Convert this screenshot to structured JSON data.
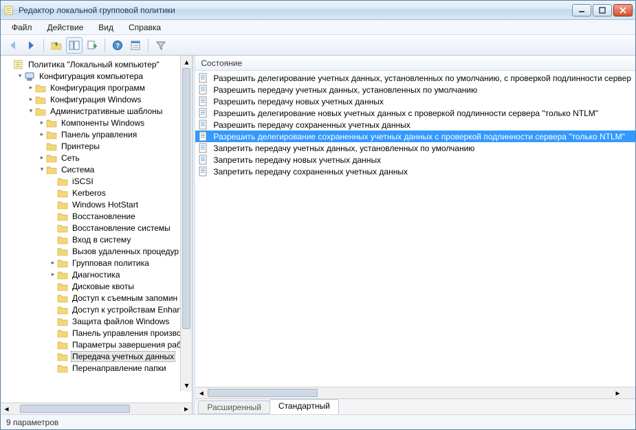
{
  "window": {
    "title": "Редактор локальной групповой политики"
  },
  "menubar": {
    "items": [
      "Файл",
      "Действие",
      "Вид",
      "Справка"
    ]
  },
  "toolbar": {
    "back": "back-icon",
    "forward": "forward-icon",
    "up": "up-icon",
    "show_hide": "show-hide-tree-icon",
    "export": "export-list-icon",
    "help": "help-icon",
    "props": "properties-icon",
    "filter": "filter-icon"
  },
  "tree": {
    "root": {
      "label": "Политика \"Локальный компьютер\"",
      "children": [
        {
          "label": "Конфигурация компьютера",
          "expanded": true,
          "children": [
            {
              "label": "Конфигурация программ",
              "expandable": true
            },
            {
              "label": "Конфигурация Windows",
              "expandable": true
            },
            {
              "label": "Административные шаблоны",
              "expanded": true,
              "children": [
                {
                  "label": "Компоненты Windows",
                  "expandable": true
                },
                {
                  "label": "Панель управления",
                  "expandable": true
                },
                {
                  "label": "Принтеры"
                },
                {
                  "label": "Сеть",
                  "expandable": true
                },
                {
                  "label": "Система",
                  "expanded": true,
                  "children": [
                    {
                      "label": "iSCSI"
                    },
                    {
                      "label": "Kerberos"
                    },
                    {
                      "label": "Windows HotStart"
                    },
                    {
                      "label": "Восстановление"
                    },
                    {
                      "label": "Восстановление системы"
                    },
                    {
                      "label": "Вход в систему"
                    },
                    {
                      "label": "Вызов удаленных процедур"
                    },
                    {
                      "label": "Групповая политика",
                      "expandable": true
                    },
                    {
                      "label": "Диагностика",
                      "expandable": true
                    },
                    {
                      "label": "Дисковые квоты"
                    },
                    {
                      "label": "Доступ к съемным запомин"
                    },
                    {
                      "label": "Доступ к устройствам Enhan"
                    },
                    {
                      "label": "Защита файлов Windows"
                    },
                    {
                      "label": "Панель управления произво"
                    },
                    {
                      "label": "Параметры завершения раб"
                    },
                    {
                      "label": "Передача учетных данных",
                      "selected": true
                    },
                    {
                      "label": "Перенаправление папки"
                    }
                  ]
                }
              ]
            }
          ]
        }
      ]
    }
  },
  "list": {
    "header": "Состояние",
    "items": [
      {
        "label": "Разрешить делегирование учетных данных, установленных по умолчанию, с проверкой подлинности сервер"
      },
      {
        "label": "Разрешить передачу учетных данных, установленных по умолчанию"
      },
      {
        "label": "Разрешить передачу новых учетных данных"
      },
      {
        "label": "Разрешить делегирование новых учетных данных с проверкой подлинности сервера \"только NTLM\""
      },
      {
        "label": "Разрешить передачу сохраненных учетных данных"
      },
      {
        "label": "Разрешить делегирование сохраненных учетных данных с проверкой подлинности сервера \"только NTLM\"",
        "selected": true
      },
      {
        "label": "Запретить передачу учетных данных, установленных по умолчанию"
      },
      {
        "label": "Запретить передачу новых учетных данных"
      },
      {
        "label": "Запретить передачу сохраненных учетных данных"
      }
    ]
  },
  "tabs": {
    "items": [
      "Расширенный",
      "Стандартный"
    ],
    "active_index": 1
  },
  "statusbar": {
    "text": "9 параметров"
  }
}
